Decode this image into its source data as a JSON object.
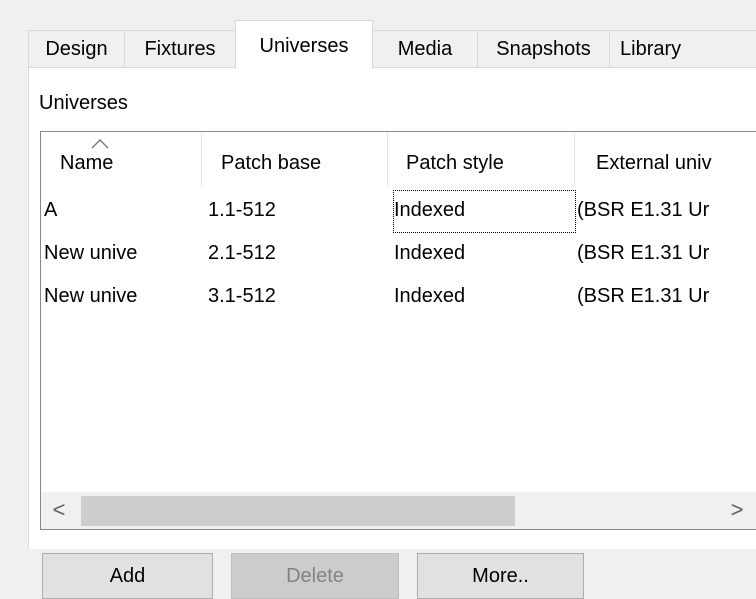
{
  "tabs": [
    {
      "label": "Design",
      "active": false
    },
    {
      "label": "Fixtures",
      "active": false
    },
    {
      "label": "Universes",
      "active": true
    },
    {
      "label": "Media",
      "active": false
    },
    {
      "label": "Snapshots",
      "active": false
    },
    {
      "label": "Library",
      "active": false
    }
  ],
  "group": {
    "label": "Universes"
  },
  "table": {
    "columns": [
      "Name",
      "Patch base",
      "Patch style",
      "External univ"
    ],
    "sort_column": "Name",
    "sort_direction": "ascending",
    "rows": [
      {
        "name": "A",
        "patch_base": "1.1-512",
        "patch_style": "Indexed",
        "external": "(BSR E1.31 Ur"
      },
      {
        "name": "New unive",
        "patch_base": "2.1-512",
        "patch_style": "Indexed",
        "external": "(BSR E1.31 Ur"
      },
      {
        "name": "New unive",
        "patch_base": "3.1-512",
        "patch_style": "Indexed",
        "external": "(BSR E1.31 Ur"
      }
    ],
    "focused_row": 0,
    "focused_column": "patch_style",
    "scroll": {
      "left_icon": "scroll-left-icon",
      "right_icon": "scroll-right-icon",
      "left_glyph": "<",
      "right_glyph": ">"
    }
  },
  "buttons": {
    "add": {
      "label": "Add",
      "enabled": true
    },
    "delete": {
      "label": "Delete",
      "enabled": false
    },
    "more": {
      "label": "More..",
      "enabled": true
    }
  },
  "colors": {
    "window_bg": "#f0f0f0",
    "panel_bg": "#ffffff",
    "border": "#828790",
    "disabled_text": "#838383"
  }
}
